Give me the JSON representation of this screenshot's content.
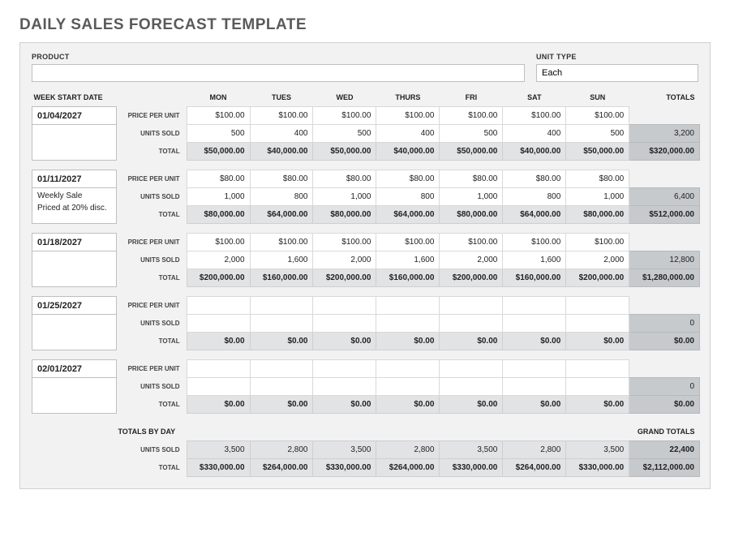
{
  "title": "DAILY SALES FORECAST TEMPLATE",
  "labels": {
    "product": "PRODUCT",
    "unit_type": "UNIT TYPE",
    "week_start": "WEEK START DATE",
    "price_per_unit": "PRICE PER UNIT",
    "units_sold": "UNITS SOLD",
    "total": "TOTAL",
    "totals_by_day": "TOTALS BY DAY",
    "grand_totals": "GRAND TOTALS"
  },
  "unit_type_value": "Each",
  "days": [
    "MON",
    "TUES",
    "WED",
    "THURS",
    "FRI",
    "SAT",
    "SUN"
  ],
  "totals_hdr": "TOTALS",
  "weeks": [
    {
      "date": "01/04/2027",
      "notes": [],
      "price": [
        "$100.00",
        "$100.00",
        "$100.00",
        "$100.00",
        "$100.00",
        "$100.00",
        "$100.00"
      ],
      "units": [
        "500",
        "400",
        "500",
        "400",
        "500",
        "400",
        "500"
      ],
      "units_total": "3,200",
      "totals": [
        "$50,000.00",
        "$40,000.00",
        "$50,000.00",
        "$40,000.00",
        "$50,000.00",
        "$40,000.00",
        "$50,000.00"
      ],
      "grand": "$320,000.00"
    },
    {
      "date": "01/11/2027",
      "notes": [
        "Weekly Sale",
        "Priced at 20% disc."
      ],
      "price": [
        "$80.00",
        "$80.00",
        "$80.00",
        "$80.00",
        "$80.00",
        "$80.00",
        "$80.00"
      ],
      "units": [
        "1,000",
        "800",
        "1,000",
        "800",
        "1,000",
        "800",
        "1,000"
      ],
      "units_total": "6,400",
      "totals": [
        "$80,000.00",
        "$64,000.00",
        "$80,000.00",
        "$64,000.00",
        "$80,000.00",
        "$64,000.00",
        "$80,000.00"
      ],
      "grand": "$512,000.00"
    },
    {
      "date": "01/18/2027",
      "notes": [],
      "price": [
        "$100.00",
        "$100.00",
        "$100.00",
        "$100.00",
        "$100.00",
        "$100.00",
        "$100.00"
      ],
      "units": [
        "2,000",
        "1,600",
        "2,000",
        "1,600",
        "2,000",
        "1,600",
        "2,000"
      ],
      "units_total": "12,800",
      "totals": [
        "$200,000.00",
        "$160,000.00",
        "$200,000.00",
        "$160,000.00",
        "$200,000.00",
        "$160,000.00",
        "$200,000.00"
      ],
      "grand": "$1,280,000.00"
    },
    {
      "date": "01/25/2027",
      "notes": [],
      "price": [
        "",
        "",
        "",
        "",
        "",
        "",
        ""
      ],
      "units": [
        "",
        "",
        "",
        "",
        "",
        "",
        ""
      ],
      "units_total": "0",
      "totals": [
        "$0.00",
        "$0.00",
        "$0.00",
        "$0.00",
        "$0.00",
        "$0.00",
        "$0.00"
      ],
      "grand": "$0.00"
    },
    {
      "date": "02/01/2027",
      "notes": [],
      "price": [
        "",
        "",
        "",
        "",
        "",
        "",
        ""
      ],
      "units": [
        "",
        "",
        "",
        "",
        "",
        "",
        ""
      ],
      "units_total": "0",
      "totals": [
        "$0.00",
        "$0.00",
        "$0.00",
        "$0.00",
        "$0.00",
        "$0.00",
        "$0.00"
      ],
      "grand": "$0.00"
    }
  ],
  "summary": {
    "units": [
      "3,500",
      "2,800",
      "3,500",
      "2,800",
      "3,500",
      "2,800",
      "3,500"
    ],
    "units_total": "22,400",
    "totals": [
      "$330,000.00",
      "$264,000.00",
      "$330,000.00",
      "$264,000.00",
      "$330,000.00",
      "$264,000.00",
      "$330,000.00"
    ],
    "grand": "$2,112,000.00"
  }
}
